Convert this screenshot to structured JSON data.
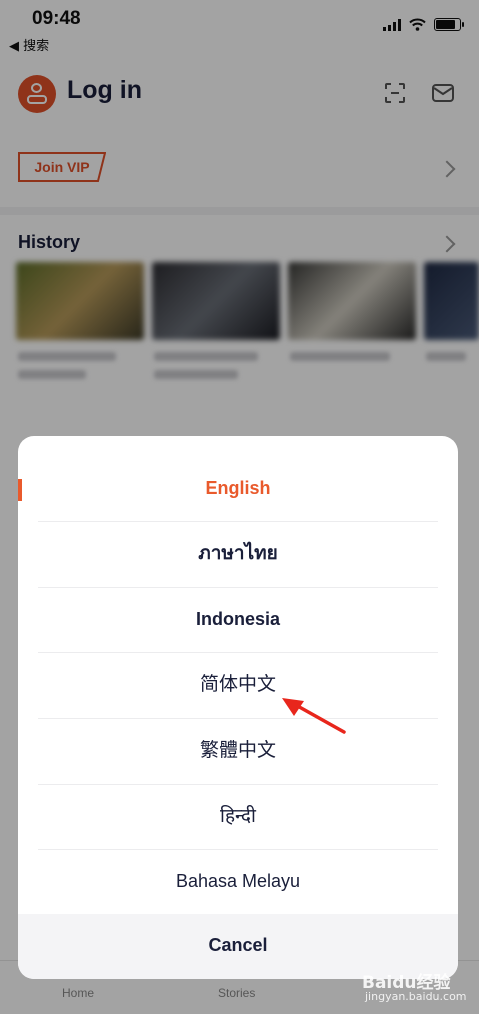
{
  "status_bar": {
    "time": "09:48",
    "back_app": "◀ 搜索"
  },
  "header": {
    "title": "Log in"
  },
  "vip": {
    "label": "Join VIP"
  },
  "history": {
    "title": "History"
  },
  "tabbar": {
    "home": "Home",
    "stories": "Stories"
  },
  "language_sheet": {
    "options": [
      {
        "label": "English",
        "selected": true
      },
      {
        "label": "ภาษาไทย",
        "selected": false
      },
      {
        "label": "Indonesia",
        "selected": false
      },
      {
        "label": "简体中文",
        "selected": false
      },
      {
        "label": "繁體中文",
        "selected": false
      },
      {
        "label": "हिन्दी",
        "selected": false
      },
      {
        "label": "Bahasa Melayu",
        "selected": false
      }
    ],
    "cancel": "Cancel"
  },
  "watermark": {
    "brand": "Baidu经验",
    "site": "jingyan.baidu.com"
  },
  "colors": {
    "accent": "#e95a2c",
    "text_dark": "#1a1f3a"
  }
}
